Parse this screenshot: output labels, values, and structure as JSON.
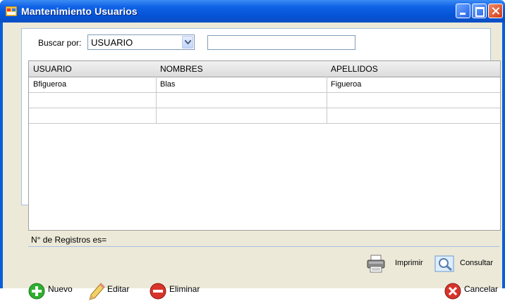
{
  "window": {
    "title": "Mantenimiento Usuarios",
    "icons": {
      "app": "app-window-icon",
      "minimize": "minimize-icon",
      "maximize": "maximize-icon",
      "close": "close-icon"
    }
  },
  "filter": {
    "label": "Buscar por:",
    "selected": "USUARIO",
    "search_value": ""
  },
  "grid": {
    "columns": [
      "USUARIO",
      "NOMBRES",
      "APELLIDOS"
    ],
    "rows": [
      [
        "Bfigueroa",
        "Blas",
        "Figueroa"
      ],
      [
        "",
        "",
        ""
      ],
      [
        "",
        "",
        ""
      ]
    ]
  },
  "status": {
    "count_label": "N° de Registros es="
  },
  "actions": {
    "print": "Imprimir",
    "consult": "Consultar"
  },
  "buttons": {
    "new": "Nuevo",
    "edit": "Editar",
    "delete": "Eliminar",
    "cancel": "Cancelar"
  },
  "colors": {
    "titlebar": "#0553d6",
    "client_bg": "#ece9d8",
    "green": "#2fae2f",
    "red": "#d8342a"
  }
}
